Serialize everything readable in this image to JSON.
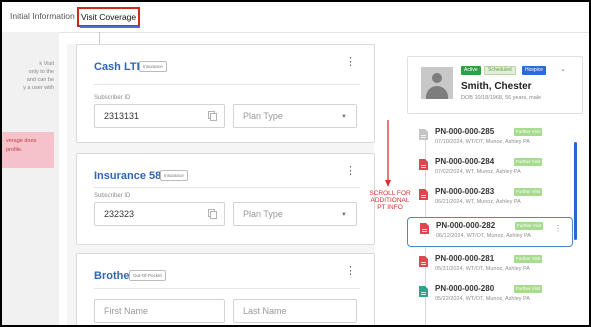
{
  "tabs": [
    {
      "label": "Initial Information"
    },
    {
      "label": "Visit Coverage"
    }
  ],
  "left_panel": {
    "text_lines": [
      "k Visit",
      "only to the",
      "and can be",
      "y a user with"
    ],
    "warning_lines": [
      "verage does",
      "profile."
    ]
  },
  "cards": [
    {
      "title": "Cash LTD",
      "badge": "Insurance",
      "subscriber_label": "Subscriber ID",
      "subscriber_id": "2313131",
      "plan_placeholder": "Plan Type"
    },
    {
      "title": "Insurance 583",
      "badge": "Insurance",
      "subscriber_label": "Subscriber ID",
      "subscriber_id": "232323",
      "plan_placeholder": "Plan Type"
    },
    {
      "title": "Brother",
      "badge": "Out-Of-Pocket",
      "first_name_placeholder": "First Name",
      "last_name_placeholder": "Last Name"
    }
  ],
  "annotation": {
    "lines": [
      "SCROLL FOR",
      "ADDITIONAL",
      "PT INFO"
    ],
    "color": "#d83030"
  },
  "patient": {
    "badges": [
      "Active",
      "Scheduled",
      "Hospice"
    ],
    "name": "Smith, Chester",
    "dob": "DOB 10/18/1968, 56 years, male"
  },
  "visits": [
    {
      "id": "PN-000-000-285",
      "badge": "Further Visit",
      "sub": "07/10/2024, WT/OT, Munoz, Ashley PA",
      "icon_color": "#c4c4c4",
      "highlight": false
    },
    {
      "id": "PN-000-000-284",
      "badge": "Further Visit",
      "sub": "07/02/2024, WT, Munoz, Ashley PA",
      "icon_color": "#e0474c",
      "highlight": false
    },
    {
      "id": "PN-000-000-283",
      "badge": "Further Visit",
      "sub": "06/21/2024, WT, Munoz, Ashley PA",
      "icon_color": "#e0474c",
      "highlight": false
    },
    {
      "id": "PN-000-000-282",
      "badge": "Further Visit",
      "sub": "06/12/2024, WT/OT, Munoz, Ashley PA",
      "icon_color": "#e0474c",
      "highlight": true
    },
    {
      "id": "PN-000-000-281",
      "badge": "Further Visit",
      "sub": "05/31/2024, WT/OT, Munoz, Ashley PA",
      "icon_color": "#e0474c",
      "highlight": false
    },
    {
      "id": "PN-000-000-280",
      "badge": "Further Visit",
      "sub": "05/22/2024, WT/OT, Munoz, Ashley PA",
      "icon_color": "#2aa58a",
      "highlight": false
    }
  ],
  "colors": {
    "accent_blue": "#2f67b6",
    "tab_highlight_border": "#d0281a",
    "further_visit_green": "#a7dc8f"
  }
}
